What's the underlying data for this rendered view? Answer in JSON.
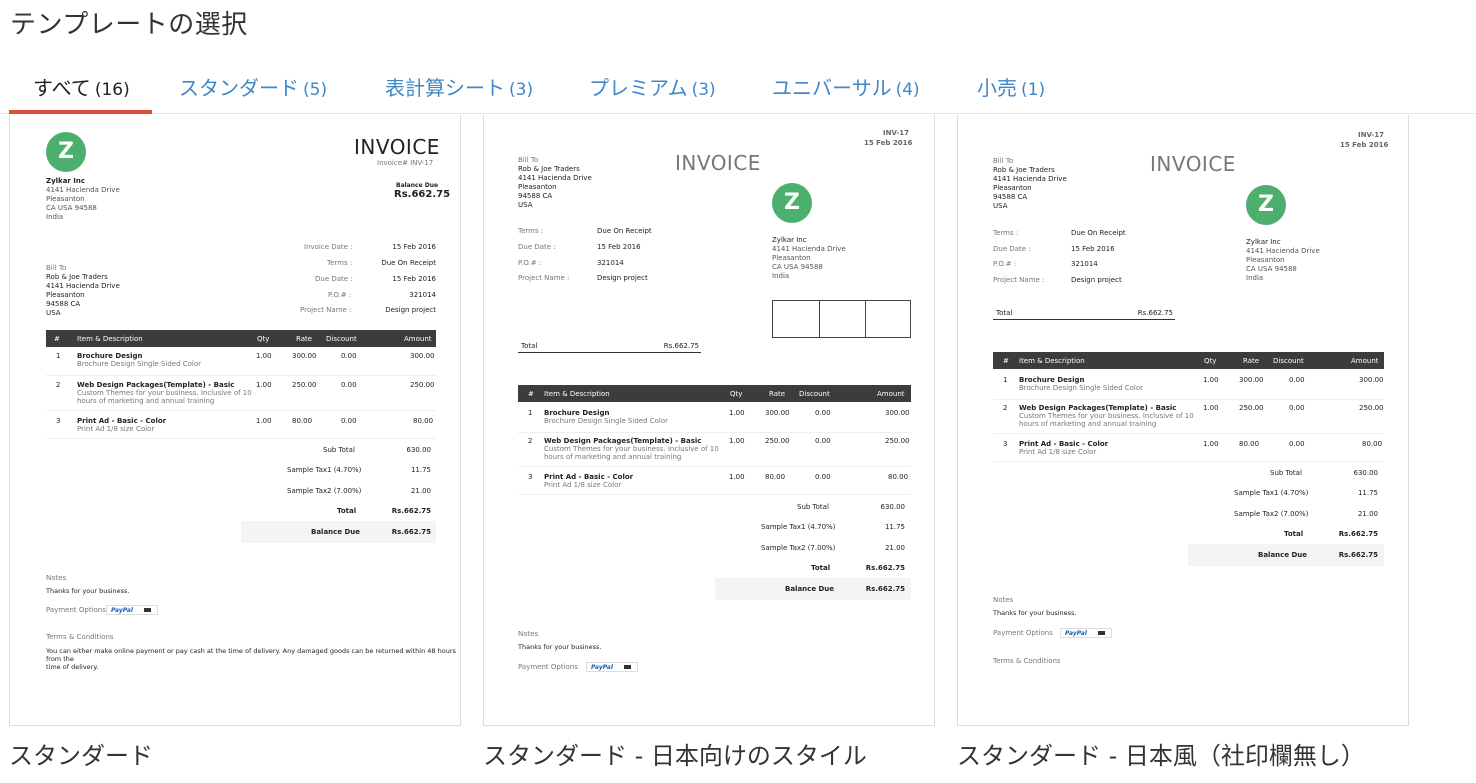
{
  "page": {
    "title": "テンプレートの選択"
  },
  "tabs": [
    {
      "label": "すべて",
      "count": "(16)",
      "active": true
    },
    {
      "label": "スタンダード",
      "count": "(5)"
    },
    {
      "label": "表計算シート",
      "count": "(3)"
    },
    {
      "label": "プレミアム",
      "count": "(3)"
    },
    {
      "label": "ユニバーサル",
      "count": "(4)"
    },
    {
      "label": "小売",
      "count": "(1)"
    }
  ],
  "colors": {
    "accent": "#d9503f",
    "link": "#3f87c8",
    "logo": "#4caf6e",
    "table_header": "#3c3c3c"
  },
  "invoice": {
    "title": "INVOICE",
    "number_label": "Invoice# INV-17",
    "number": "INV-17",
    "date": "15 Feb 2016",
    "logo_letter": "Z",
    "company": {
      "name": "Zylkar Inc",
      "line1": "4141 Hacienda Drive",
      "line2": "Pleasanton",
      "line3": "CA USA 94588",
      "line4": "India"
    },
    "balance_due_label": "Balance Due",
    "balance_due": "Rs.662.75",
    "bill_to": {
      "label": "Bill To",
      "name": "Rob & Joe Traders",
      "line1": "4141 Hacienda Drive",
      "line2": "Pleasanton",
      "line3": "94588 CA",
      "line4": "USA"
    },
    "fields": [
      {
        "label": "Invoice Date :",
        "value": "15 Feb 2016"
      },
      {
        "label": "Terms :",
        "value": "Due On Receipt"
      },
      {
        "label": "Due Date :",
        "value": "15 Feb 2016"
      },
      {
        "label": "P.O.# :",
        "value": "321014"
      },
      {
        "label": "Project Name :",
        "value": "Design project"
      }
    ],
    "columns": {
      "num": "#",
      "item": "Item & Description",
      "qty": "Qty",
      "rate": "Rate",
      "discount": "Discount",
      "amount": "Amount"
    },
    "items": [
      {
        "num": "1",
        "name": "Brochure Design",
        "desc1": "Brochure Design Single Sided Color",
        "desc2": "",
        "qty": "1.00",
        "rate": "300.00",
        "discount": "0.00",
        "amount": "300.00"
      },
      {
        "num": "2",
        "name": "Web Design Packages(Template) - Basic",
        "desc1": "Custom Themes for your business. Inclusive of 10",
        "desc2": "hours of marketing and annual training",
        "qty": "1.00",
        "rate": "250.00",
        "discount": "0.00",
        "amount": "250.00"
      },
      {
        "num": "3",
        "name": "Print Ad - Basic - Color",
        "desc1": "Print Ad 1/8 size Color",
        "desc2": "",
        "qty": "1.00",
        "rate": "80.00",
        "discount": "0.00",
        "amount": "80.00"
      }
    ],
    "totals": [
      {
        "label": "Sub Total",
        "value": "630.00"
      },
      {
        "label": "Sample Tax1 (4.70%)",
        "value": "11.75"
      },
      {
        "label": "Sample Tax2 (7.00%)",
        "value": "21.00"
      },
      {
        "label": "Total",
        "value": "Rs.662.75"
      },
      {
        "label": "Balance Due",
        "value": "Rs.662.75"
      }
    ],
    "total_label": "Total",
    "total_value": "Rs.662.75",
    "notes_label": "Notes",
    "notes_text": "Thanks for your business.",
    "payment_label": "Payment Options",
    "paypal": "PayPal",
    "terms_label": "Terms & Conditions",
    "terms_text1": "You can either make online payment or pay cash at the time of delivery. Any damaged goods can be returned within 48 hours from the",
    "terms_text2": "time of delivery."
  },
  "templates": [
    {
      "caption": "スタンダード"
    },
    {
      "caption": "スタンダード - 日本向けのスタイル"
    },
    {
      "caption": "スタンダード - 日本風（社印欄無し）"
    }
  ]
}
